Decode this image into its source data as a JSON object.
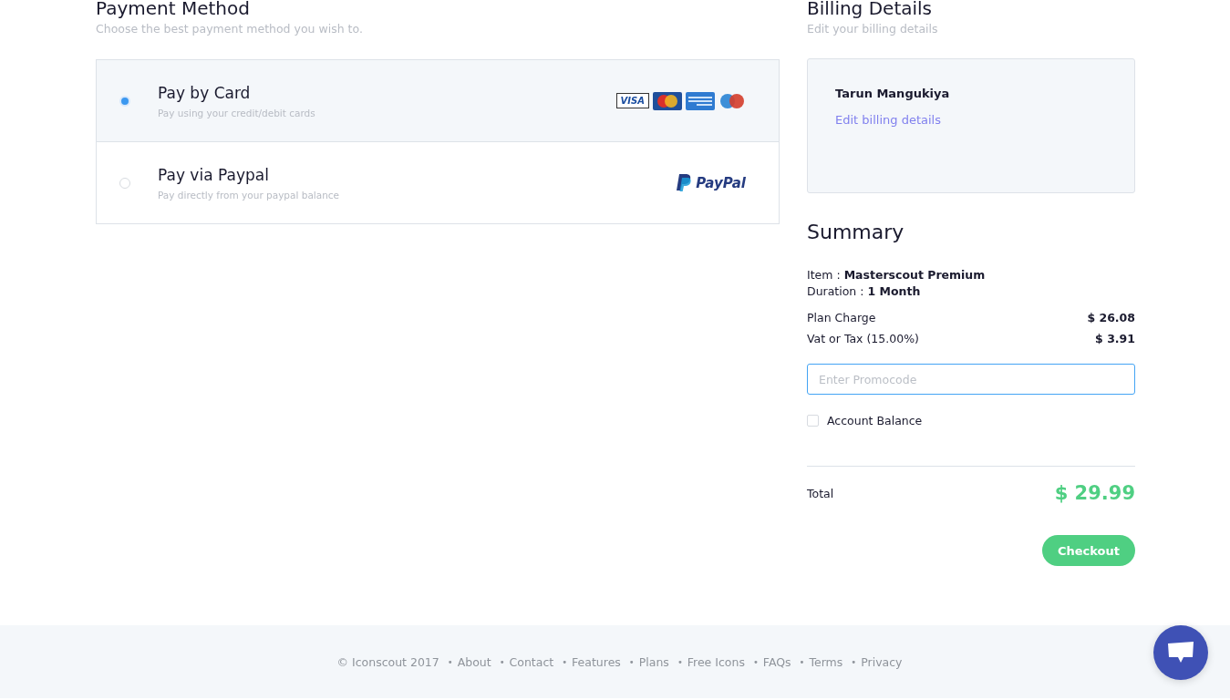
{
  "payment": {
    "title": "Payment Method",
    "subtitle": "Choose the best payment method you wish to.",
    "options": [
      {
        "kind": "card",
        "label": "Pay by Card",
        "description": "Pay using your credit/debit cards",
        "selected": true,
        "logo_text": "VISA"
      },
      {
        "kind": "paypal",
        "label": "Pay via Paypal",
        "description": "Pay directly from your paypal balance",
        "selected": false,
        "logo_text": "PayPal"
      }
    ]
  },
  "billing": {
    "title": "Billing Details",
    "subtitle": "Edit your billing details",
    "name": "Tarun Mangukiya",
    "edit_link": "Edit billing details"
  },
  "summary": {
    "title": "Summary",
    "details": [
      {
        "label": "Item :",
        "value": "Masterscout Premium"
      },
      {
        "label": "Duration :",
        "value": "1 Month"
      }
    ],
    "charges": [
      {
        "label": "Plan Charge",
        "amount": "$ 26.08"
      },
      {
        "label": "Vat or Tax (15.00%)",
        "amount": "$ 3.91"
      }
    ],
    "promocode": {
      "placeholder": "Enter Promocode"
    },
    "account_balance": {
      "label": "Account Balance",
      "checked": false
    },
    "total": {
      "label": "Total",
      "amount": "$ 29.99"
    },
    "checkout": "Checkout"
  },
  "footer": {
    "copyright": "© Iconscout 2017",
    "separator": "•",
    "links": [
      "About",
      "Contact",
      "Features",
      "Plans",
      "Free Icons",
      "FAQs",
      "Terms",
      "Privacy"
    ]
  }
}
